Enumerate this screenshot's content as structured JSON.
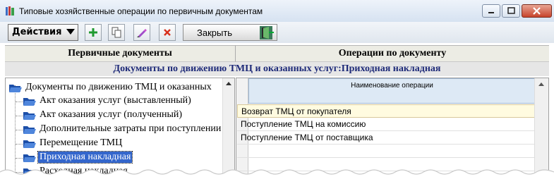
{
  "window": {
    "title": "Типовые хозяйственные операции по первичным документам",
    "app_icon": "books-icon",
    "controls": [
      "minimize-icon",
      "maximize-icon",
      "close-icon"
    ]
  },
  "toolbar": {
    "actions_label": "Действия",
    "add_icon": "plus-icon",
    "copy_icon": "copy-icon",
    "edit_icon": "pencil-icon",
    "delete_icon": "x-icon",
    "close_label": "Закрыть",
    "close_icon": "door-exit-icon"
  },
  "panels": {
    "left_header": "Первичные документы",
    "right_header": "Операции по документу",
    "subtitle": "Документы по движению ТМЦ и оказанных услуг:Приходная накладная"
  },
  "tree": {
    "root": "Документы по движению ТМЦ и оказанных",
    "items": [
      "Акт оказания услуг (выставленный)",
      "Акт оказания услуг (полученный)",
      "Дополнительные затраты при поступлении",
      "Перемещение ТМЦ",
      "Приходная накладная",
      "Расходная накладная"
    ],
    "selected_index": 4
  },
  "grid": {
    "column_header": "Наименование операции",
    "rows": [
      "Возврат ТМЦ от покупателя",
      "Поступление ТМЦ на комиссию",
      "Поступление ТМЦ от поставщика"
    ],
    "selected_index": 0
  },
  "colors": {
    "subtitle_text": "#1e2a78",
    "tree_selection": "#3366cc",
    "grid_header_bg": "#dde9f5",
    "grid_selection_bg": "#fffbe0"
  }
}
